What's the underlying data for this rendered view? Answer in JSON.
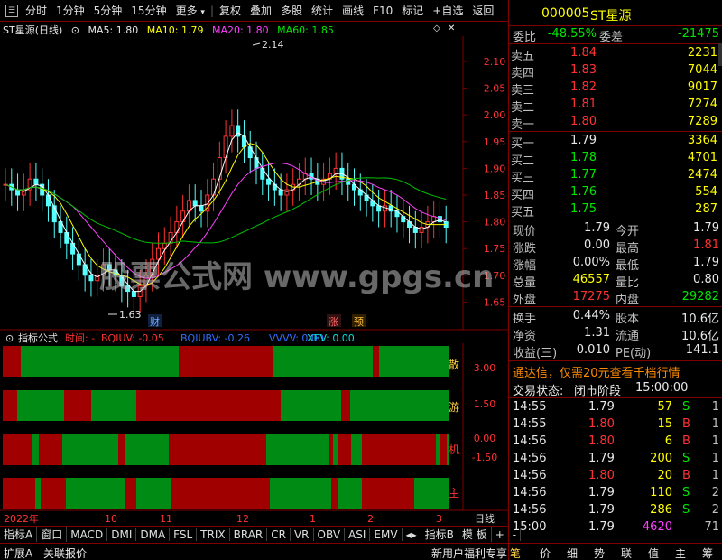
{
  "toolbar": {
    "items": [
      "分时",
      "1分钟",
      "5分钟",
      "15分钟",
      "更多",
      "复权",
      "叠加",
      "多股",
      "统计",
      "画线",
      "F10",
      "标记",
      "+自选",
      "返回"
    ]
  },
  "chart": {
    "title": "ST星源(日线)",
    "ma5": "MA5: 1.80",
    "ma10": "MA10: 1.79",
    "ma20": "MA20: 1.80",
    "ma60": "MA60: 1.85",
    "y_labels": [
      "2.10",
      "2.05",
      "2.00",
      "1.95",
      "1.90",
      "1.85",
      "1.80",
      "1.75",
      "1.70",
      "1.65"
    ],
    "high_label": "2.14",
    "low_label": "1.63",
    "event_labels": [
      "财",
      "涨",
      "预"
    ],
    "watermark": "股票公式网 www.gpgs.cn"
  },
  "indicator": {
    "title": "指标公式",
    "time_label": "时间: -",
    "bqiuv": "BQIUV: -0.05",
    "bqiubv": "BQIUBV: -0.26",
    "vvvv": "VVVV: 0.00",
    "xev": "XEV: 0.00",
    "y_labels": [
      "3.00",
      "1.50",
      "0.00",
      "-1.50"
    ],
    "side_labels": [
      "散",
      "游",
      "机",
      "主"
    ]
  },
  "x_axis": {
    "labels": [
      "2022年",
      "10",
      "11",
      "12",
      "1",
      "2",
      "3"
    ],
    "period": "日线"
  },
  "tabs": [
    "指标A",
    "窗口",
    "MACD",
    "DMI",
    "DMA",
    "FSL",
    "TRIX",
    "BRAR",
    "CR",
    "VR",
    "OBV",
    "ASI",
    "EMV",
    "指标B",
    "模 板",
    "+",
    "-"
  ],
  "status": {
    "left1": "扩展A",
    "left2": "关联报价",
    "promo": "新用户福利专享",
    "right_tabs": [
      "笔",
      "价",
      "细",
      "势",
      "联",
      "值",
      "主",
      "筹"
    ]
  },
  "quote": {
    "code": "000005",
    "name": "ST星源",
    "weibi_label": "委比",
    "weibi": "-48.55%",
    "weicha_label": "委差",
    "weicha": "-21475",
    "asks": [
      {
        "label": "卖五",
        "price": "1.84",
        "vol": "2231"
      },
      {
        "label": "卖四",
        "price": "1.83",
        "vol": "7044"
      },
      {
        "label": "卖三",
        "price": "1.82",
        "vol": "9017"
      },
      {
        "label": "卖二",
        "price": "1.81",
        "vol": "7274"
      },
      {
        "label": "卖一",
        "price": "1.80",
        "vol": "7289"
      }
    ],
    "bids": [
      {
        "label": "买一",
        "price": "1.79",
        "vol": "3364"
      },
      {
        "label": "买二",
        "price": "1.78",
        "vol": "4701"
      },
      {
        "label": "买三",
        "price": "1.77",
        "vol": "2474"
      },
      {
        "label": "买四",
        "price": "1.76",
        "vol": "554"
      },
      {
        "label": "买五",
        "price": "1.75",
        "vol": "287"
      }
    ],
    "stats": [
      {
        "l1": "现价",
        "v1": "1.79",
        "l2": "今开",
        "v2": "1.79"
      },
      {
        "l1": "涨跌",
        "v1": "0.00",
        "l2": "最高",
        "v2": "1.81"
      },
      {
        "l1": "涨幅",
        "v1": "0.00%",
        "l2": "最低",
        "v2": "1.79"
      },
      {
        "l1": "总量",
        "v1": "46557",
        "l2": "量比",
        "v2": "0.80"
      },
      {
        "l1": "外盘",
        "v1": "17275",
        "l2": "内盘",
        "v2": "29282"
      }
    ],
    "stats2": [
      {
        "l1": "换手",
        "v1": "0.44%",
        "l2": "股本",
        "v2": "10.6亿"
      },
      {
        "l1": "净资",
        "v1": "1.31",
        "l2": "流通",
        "v2": "10.6亿"
      },
      {
        "l1": "收益(三)",
        "v1": "0.010",
        "l2": "PE(动)",
        "v2": "141.1"
      }
    ],
    "ad": "通达信，仅需20元查看千档行情",
    "trade_state_label": "交易状态:",
    "trade_state": "闭市阶段",
    "trade_time": "15:00:00",
    "ticks": [
      {
        "t": "14:55",
        "p": "1.79",
        "v": "57",
        "s": "S",
        "n": "1"
      },
      {
        "t": "14:55",
        "p": "1.80",
        "v": "15",
        "s": "B",
        "n": "1"
      },
      {
        "t": "14:56",
        "p": "1.80",
        "v": "6",
        "s": "B",
        "n": "1"
      },
      {
        "t": "14:56",
        "p": "1.79",
        "v": "200",
        "s": "S",
        "n": "1"
      },
      {
        "t": "14:56",
        "p": "1.80",
        "v": "20",
        "s": "B",
        "n": "1"
      },
      {
        "t": "14:56",
        "p": "1.79",
        "v": "110",
        "s": "S",
        "n": "2"
      },
      {
        "t": "14:56",
        "p": "1.79",
        "v": "286",
        "s": "S",
        "n": "2"
      },
      {
        "t": "15:00",
        "p": "1.79",
        "v": "4620",
        "s": "",
        "n": "71"
      }
    ]
  }
}
